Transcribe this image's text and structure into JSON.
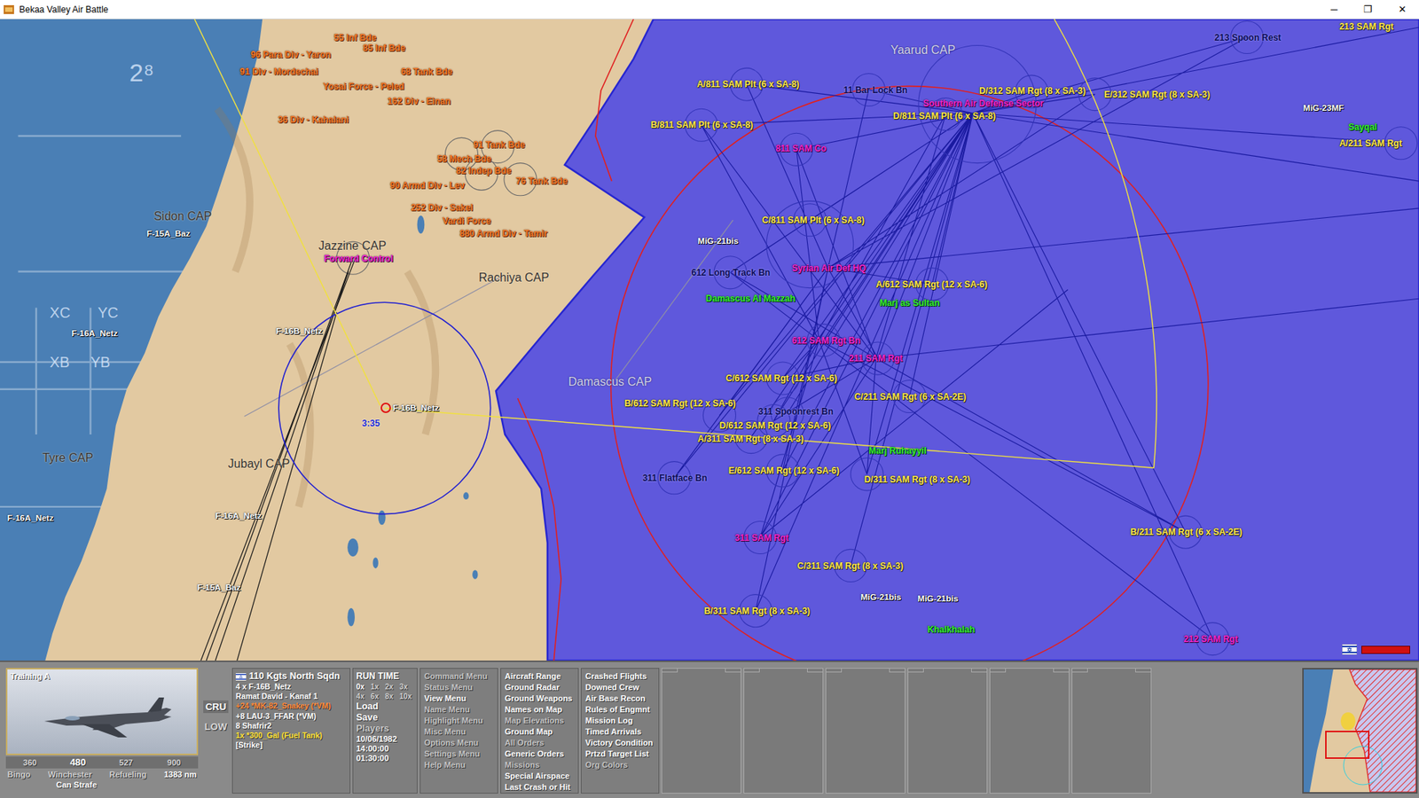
{
  "window": {
    "title": "Bekaa Valley Air Battle",
    "controls": [
      "─",
      "❐",
      "✕"
    ]
  },
  "map": {
    "labels": [
      {
        "text": "55 Inf Bde",
        "kind": "unit"
      },
      {
        "text": "85 Inf Bde",
        "kind": "unit"
      },
      {
        "text": "96 Para Div - Yaron",
        "kind": "unit"
      },
      {
        "text": "91 Div - Mordechai",
        "kind": "unit"
      },
      {
        "text": "68 Tank Bde",
        "kind": "unit"
      },
      {
        "text": "Yosai Force - Peled",
        "kind": "unit"
      },
      {
        "text": "162 Div - Einan",
        "kind": "unit"
      },
      {
        "text": "36 Div - Kahalani",
        "kind": "unit"
      },
      {
        "text": "91 Tank Bde",
        "kind": "unit"
      },
      {
        "text": "58 Mech Bde",
        "kind": "unit"
      },
      {
        "text": "82 Indep Bde",
        "kind": "unit"
      },
      {
        "text": "76 Tank Bde",
        "kind": "unit"
      },
      {
        "text": "90 Armd Div - Lev",
        "kind": "unit"
      },
      {
        "text": "252 Div - Sakel",
        "kind": "unit"
      },
      {
        "text": "Vardi Force",
        "kind": "unit"
      },
      {
        "text": "880 Armd Div - Tamir",
        "kind": "unit"
      },
      {
        "text": "Sidon CAP",
        "kind": "cap"
      },
      {
        "text": "Jazzine CAP",
        "kind": "cap"
      },
      {
        "text": "Rachiya CAP",
        "kind": "cap"
      },
      {
        "text": "Tyre CAP",
        "kind": "cap"
      },
      {
        "text": "Jubayl CAP",
        "kind": "cap"
      },
      {
        "text": "Damascus CAP",
        "kind": "cap-syria"
      },
      {
        "text": "Yaarud CAP",
        "kind": "cap-syria"
      },
      {
        "text": "Forward Control",
        "kind": "hq"
      },
      {
        "text": "A/811 SAM Plt (6 x SA-8)",
        "kind": "sam"
      },
      {
        "text": "B/811 SAM Plt (6 x SA-8)",
        "kind": "sam"
      },
      {
        "text": "D/312 SAM Rgt (8 x SA-3)",
        "kind": "sam"
      },
      {
        "text": "E/312 SAM Rgt (8 x SA-3)",
        "kind": "sam"
      },
      {
        "text": "D/811 SAM Plt (6 x SA-8)",
        "kind": "sam"
      },
      {
        "text": "C/811 SAM Plt (6 x SA-8)",
        "kind": "sam"
      },
      {
        "text": "A/612 SAM Rgt (12 x SA-6)",
        "kind": "sam"
      },
      {
        "text": "C/612 SAM Rgt (12 x SA-6)",
        "kind": "sam"
      },
      {
        "text": "C/211 SAM Rgt (6 x SA-2E)",
        "kind": "sam"
      },
      {
        "text": "B/612 SAM Rgt (12 x SA-6)",
        "kind": "sam"
      },
      {
        "text": "D/612 SAM Rgt (12 x SA-6)",
        "kind": "sam"
      },
      {
        "text": "A/311 SAM Rgt (8 x SA-3)",
        "kind": "sam"
      },
      {
        "text": "E/612 SAM Rgt (12 x SA-6)",
        "kind": "sam"
      },
      {
        "text": "D/311 SAM Rgt (8 x SA-3)",
        "kind": "sam"
      },
      {
        "text": "C/311 SAM Rgt (8 x SA-3)",
        "kind": "sam"
      },
      {
        "text": "B/311 SAM Rgt (8 x SA-3)",
        "kind": "sam"
      },
      {
        "text": "B/211 SAM Rgt (6 x SA-2E)",
        "kind": "sam"
      },
      {
        "text": "A/211 SAM Rgt",
        "kind": "sam"
      },
      {
        "text": "213 SAM Rgt",
        "kind": "sam"
      },
      {
        "text": "Southern Air Defense Sector",
        "kind": "hq"
      },
      {
        "text": "811 SAM Co",
        "kind": "hq"
      },
      {
        "text": "Syrian Air Def HQ",
        "kind": "hq"
      },
      {
        "text": "612 SAM Rgt Bn",
        "kind": "hq"
      },
      {
        "text": "211 SAM Rgt",
        "kind": "hq"
      },
      {
        "text": "311 SAM Rgt",
        "kind": "hq"
      },
      {
        "text": "212 SAM Rgt",
        "kind": "hq"
      },
      {
        "text": "11 Bar Lock Bn",
        "kind": "radar"
      },
      {
        "text": "213 Spoon Rest",
        "kind": "radar"
      },
      {
        "text": "612 Long Track Bn",
        "kind": "radar"
      },
      {
        "text": "311 Spoonrest Bn",
        "kind": "radar"
      },
      {
        "text": "311 Flatface Bn",
        "kind": "radar"
      },
      {
        "text": "Damascus Al Mazzah",
        "kind": "airbase"
      },
      {
        "text": "Marj as Sultan",
        "kind": "airbase"
      },
      {
        "text": "Marj Ruhayyil",
        "kind": "airbase"
      },
      {
        "text": "Khalkhalah",
        "kind": "airbase"
      },
      {
        "text": "Sayqal",
        "kind": "airbase"
      },
      {
        "text": "2⁸",
        "kind": "grid-big"
      },
      {
        "text": "XC",
        "kind": "grid"
      },
      {
        "text": "YC",
        "kind": "grid"
      },
      {
        "text": "XB",
        "kind": "grid"
      },
      {
        "text": "YB",
        "kind": "grid"
      }
    ],
    "flights": [
      {
        "text": "F-15A_Baz",
        "selected": false
      },
      {
        "text": "F-16A_Netz",
        "selected": false
      },
      {
        "text": "F-16B_Netz",
        "selected": false
      },
      {
        "text": "F-16B_Netz",
        "selected": true
      },
      {
        "text": "F-16A_Netz",
        "selected": false
      },
      {
        "text": "F-16A_Netz",
        "selected": false
      },
      {
        "text": "F-15A_Baz",
        "selected": false
      },
      {
        "text": "MiG-21bis",
        "selected": false
      },
      {
        "text": "MiG-23MF",
        "selected": false
      },
      {
        "text": "MiG-21bis",
        "selected": false
      },
      {
        "text": "MiG-21bis",
        "selected": false
      }
    ],
    "flight_timer": "3:35"
  },
  "panel": {
    "photo": {
      "caption": "Training A"
    },
    "speeds": [
      {
        "text": "360",
        "selected": false
      },
      {
        "text": "480",
        "selected": true
      },
      {
        "text": "527",
        "selected": false
      },
      {
        "text": "900",
        "selected": false
      }
    ],
    "flags": [
      {
        "text": "Bingo",
        "on": false
      },
      {
        "text": "Winchester",
        "on": false
      },
      {
        "text": "Refueling",
        "on": false
      },
      {
        "text": "Can Strafe",
        "on": true
      }
    ],
    "range": "1383 nm",
    "altitude_modes": [
      {
        "text": "CRU",
        "selected": true
      },
      {
        "text": "LOW",
        "selected": false
      }
    ],
    "unit": {
      "name": "110 Kgts North Sqdn",
      "lines": [
        {
          "text": "4 x F-16B_Netz",
          "color": "#ffffff"
        },
        {
          "text": "Ramat David - Kanaf 1",
          "color": "#ffffff"
        },
        {
          "text": "+24 *MK-82_Snakey (*VM)",
          "color": "#ff8a3c"
        },
        {
          "text": "+8 LAU-3_FFAR (*VM)",
          "color": "#ffffff"
        },
        {
          "text": "8 Shafrir2",
          "color": "#ffffff"
        },
        {
          "text": "1x *300_Gal (Fuel Tank)",
          "color": "#ffe23a"
        },
        {
          "text": "[Strike]",
          "color": "#ffffff"
        }
      ]
    },
    "runtime": {
      "title": "RUN TIME",
      "speeds": [
        {
          "text": "0x",
          "selected": true
        },
        {
          "text": "1x",
          "selected": false
        },
        {
          "text": "2x",
          "selected": false
        },
        {
          "text": "3x",
          "selected": false
        },
        {
          "text": "4x",
          "selected": false
        },
        {
          "text": "6x",
          "selected": false
        },
        {
          "text": "8x",
          "selected": false
        },
        {
          "text": "10x",
          "selected": false
        }
      ],
      "buttons": [
        {
          "text": "Load",
          "enabled": true
        },
        {
          "text": "Save",
          "enabled": true
        },
        {
          "text": "Players",
          "enabled": false
        }
      ],
      "date": "10/06/1982",
      "time": "14:00:00",
      "elapsed": "01:30:00"
    },
    "menus": [
      [
        {
          "text": "Command Menu",
          "on": false
        },
        {
          "text": "Status Menu",
          "on": false
        },
        {
          "text": "View Menu",
          "on": true
        },
        {
          "text": "Name Menu",
          "on": false
        },
        {
          "text": "Highlight Menu",
          "on": false
        },
        {
          "text": "Misc Menu",
          "on": false
        },
        {
          "text": "Options Menu",
          "on": false
        },
        {
          "text": "Settings Menu",
          "on": false
        },
        {
          "text": "Help Menu",
          "on": false
        }
      ],
      [
        {
          "text": "Aircraft Range",
          "on": true
        },
        {
          "text": "Ground Radar",
          "on": true
        },
        {
          "text": "Ground Weapons",
          "on": true
        },
        {
          "text": "Names on Map",
          "on": true
        },
        {
          "text": "Map Elevations",
          "on": false
        },
        {
          "text": "Ground Map",
          "on": true
        },
        {
          "text": "All Orders",
          "on": false
        },
        {
          "text": "Generic Orders",
          "on": true
        },
        {
          "text": "Missions",
          "on": false
        },
        {
          "text": "Special Airspace",
          "on": true
        },
        {
          "text": "Last Crash or Hit",
          "on": true
        }
      ],
      [
        {
          "text": "Crashed Flights",
          "on": true
        },
        {
          "text": "Downed Crew",
          "on": true
        },
        {
          "text": "Air Base Recon",
          "on": true
        },
        {
          "text": "Rules of Engmnt",
          "on": true
        },
        {
          "text": "Mission Log",
          "on": true
        },
        {
          "text": "Timed Arrivals",
          "on": true
        },
        {
          "text": "Victory Condition",
          "on": true
        },
        {
          "text": "Prtzd Target List",
          "on": true
        },
        {
          "text": "Org Colors",
          "on": false
        }
      ]
    ],
    "slots": [
      {
        "empty": true
      },
      {
        "empty": true
      },
      {
        "empty": true
      },
      {
        "empty": true
      },
      {
        "empty": true
      },
      {
        "empty": true
      }
    ]
  }
}
